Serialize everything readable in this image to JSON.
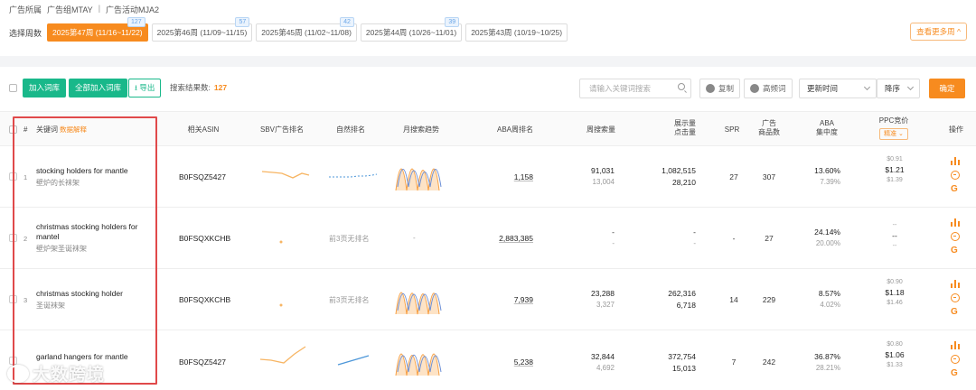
{
  "breadcrumb": {
    "items": [
      "广告所属",
      "广告组MTAY",
      "|",
      "广告活动MJA2"
    ]
  },
  "week_selector": {
    "label": "选择周数",
    "weeks": [
      {
        "label": "2025第47周 (11/16~11/22)",
        "badge": "127",
        "active": true
      },
      {
        "label": "2025第46周 (11/09~11/15)",
        "badge": "57",
        "active": false
      },
      {
        "label": "2025第45周 (11/02~11/08)",
        "badge": "42",
        "active": false
      },
      {
        "label": "2025第44周 (10/26~11/01)",
        "badge": "39",
        "active": false
      },
      {
        "label": "2025第43周 (10/19~10/25)",
        "badge": "",
        "active": false
      }
    ],
    "more_label": "查看更多周 ^"
  },
  "toolbar": {
    "add_label": "加入词库",
    "add_all_label": "全部加入词库",
    "export_label": "导出",
    "result_label": "搜索结果数:",
    "result_count": "127",
    "search_placeholder": "请输入关键词搜索",
    "copy_label": "复制",
    "hide_label": "高频词",
    "sort_field": "更新时间",
    "sort_order": "降序",
    "confirm_label": "确定"
  },
  "table": {
    "headers": {
      "index": "#",
      "keyword": "关键词",
      "keyword_link": "数据解释",
      "asin": "相关ASIN",
      "sbv": "SBV广告排名",
      "natural": "自然排名",
      "trend": "月搜索趋势",
      "aba_rank": "ABA周排名",
      "weekly_search": "周搜索量",
      "impression_line1": "展示量",
      "impression_line2": "点击量",
      "spr": "SPR",
      "products_line1": "广告",
      "products_line2": "商品数",
      "aba_conc_line1": "ABA",
      "aba_conc_line2": "集中度",
      "ppc": "PPC竞价",
      "ppc_pill": "精准",
      "ops": "操作"
    },
    "rows": [
      {
        "idx": "1",
        "kw_en": "stocking holders for mantle",
        "kw_cn": "壁炉的长袜架",
        "asin": "B0FSQZ5427",
        "natural": "",
        "trend": "",
        "aba_rank": "1,158",
        "search_main": "91,031",
        "search_sub": "13,004",
        "imp_main": "1,082,515",
        "imp_sub": "28,210",
        "spr": "27",
        "products": "307",
        "conc_main": "13.60%",
        "conc_sub": "7.39%",
        "ppc_low": "$0.91",
        "ppc_mid": "$1.21",
        "ppc_high": "$1.39"
      },
      {
        "idx": "2",
        "kw_en": "christmas stocking holders for mantel",
        "kw_cn": "壁炉架圣诞袜架",
        "asin": "B0FSQXKCHB",
        "natural": "前3页无排名",
        "trend": "-",
        "aba_rank": "2,883,385",
        "search_main": "-",
        "search_sub": "-",
        "imp_main": "-",
        "imp_sub": "-",
        "spr": "-",
        "products": "27",
        "conc_main": "24.14%",
        "conc_sub": "20.00%",
        "ppc_low": "--",
        "ppc_mid": "--",
        "ppc_high": "--"
      },
      {
        "idx": "3",
        "kw_en": "christmas stocking holder",
        "kw_cn": "圣诞袜架",
        "asin": "B0FSQXKCHB",
        "natural": "前3页无排名",
        "trend": "",
        "aba_rank": "7,939",
        "search_main": "23,288",
        "search_sub": "3,327",
        "imp_main": "262,316",
        "imp_sub": "6,718",
        "spr": "14",
        "products": "229",
        "conc_main": "8.57%",
        "conc_sub": "4.02%",
        "ppc_low": "$0.90",
        "ppc_mid": "$1.18",
        "ppc_high": "$1.46"
      },
      {
        "idx": "4",
        "kw_en": "garland hangers for mantle",
        "kw_cn": "",
        "asin": "B0FSQZ5427",
        "natural": "",
        "trend": "",
        "aba_rank": "5,238",
        "search_main": "32,844",
        "search_sub": "4,692",
        "imp_main": "372,754",
        "imp_sub": "15,013",
        "spr": "7",
        "products": "242",
        "conc_main": "36.87%",
        "conc_sub": "28.21%",
        "ppc_low": "$0.80",
        "ppc_mid": "$1.06",
        "ppc_high": "$1.33"
      }
    ]
  },
  "watermark": "大数跨境",
  "colors": {
    "accent": "#f78b1f",
    "green": "#19b88a",
    "highlight": "#e0494a"
  }
}
